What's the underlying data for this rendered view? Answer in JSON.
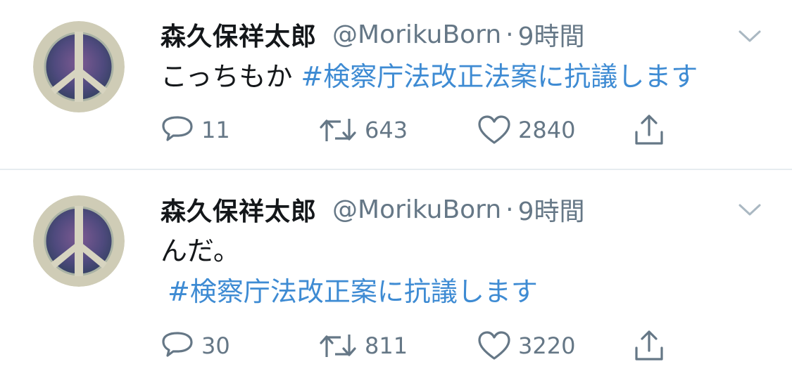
{
  "tweets": [
    {
      "author_name": "森久保祥太郎",
      "handle": "@MorikuBorn",
      "separator": "·",
      "time": "9時間",
      "text": "こっちもか ",
      "hashtag": "#検察庁法改正法案に抗議します",
      "replies": "11",
      "retweets": "643",
      "likes": "2840"
    },
    {
      "author_name": "森久保祥太郎",
      "handle": "@MorikuBorn",
      "separator": "·",
      "time": "9時間",
      "text": "んだ。",
      "hashtag": "#検察庁法改正案に抗議します",
      "replies": "30",
      "retweets": "811",
      "likes": "3220"
    }
  ],
  "icons": {
    "reply": "reply-icon",
    "retweet": "retweet-icon",
    "like": "heart-icon",
    "share": "share-icon",
    "menu": "chevron-down-icon"
  },
  "colors": {
    "text": "#14171a",
    "secondary": "#657786",
    "hashtag": "#3e8bd3",
    "divider": "#e6ecf0"
  }
}
